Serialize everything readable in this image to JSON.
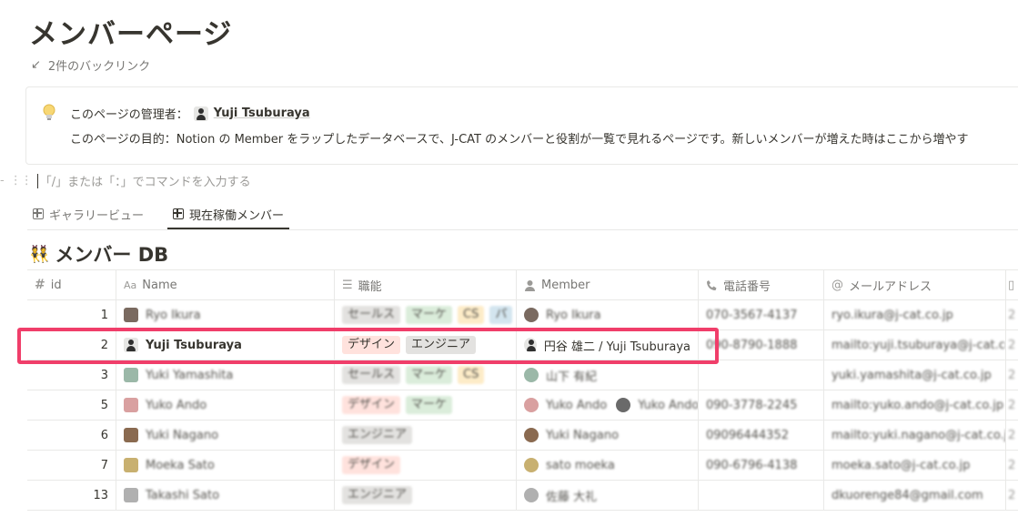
{
  "page": {
    "title": "メンバーページ",
    "backlinks_icon": "↙",
    "backlinks_label": "2件のバックリンク"
  },
  "callout": {
    "icon": "lightbulb-icon",
    "admin_label": "このページの管理者：",
    "admin_name": "Yuji Tsuburaya",
    "purpose": "このページの目的：Notion の Member をラップしたデータベースで、J-CAT のメンバーと役割が一覧で見れるページです。新しいメンバーが増えた時はここから増やす"
  },
  "command_hint": "「/」または「：」でコマンドを入力する",
  "tabs": [
    {
      "label": "ギャラリービュー",
      "active": false
    },
    {
      "label": "現在稼働メンバー",
      "active": true
    }
  ],
  "database": {
    "emoji": "👯",
    "title": "メンバー DB",
    "columns": [
      {
        "icon": "#",
        "label": "id"
      },
      {
        "icon": "Aa",
        "label": "Name"
      },
      {
        "icon": "☰",
        "label": "職能"
      },
      {
        "icon": "person",
        "label": "Member"
      },
      {
        "icon": "phone",
        "label": "電話番号"
      },
      {
        "icon": "@",
        "label": "メールアドレス"
      }
    ],
    "rows": [
      {
        "id": "1",
        "name": "Ryo Ikura",
        "tags": [
          [
            "セールス",
            "sales"
          ],
          [
            "マーケ",
            "mkt"
          ],
          [
            "CS",
            "cs"
          ],
          [
            "パ",
            "p"
          ]
        ],
        "member": "Ryo Ikura",
        "phone": "070-3567-4137",
        "email": "ryo.ikura@j-cat.co.jp",
        "blur": true,
        "av": "#7a6a60"
      },
      {
        "id": "2",
        "name": "Yuji Tsuburaya",
        "tags": [
          [
            "デザイン",
            "design"
          ],
          [
            "エンジニア",
            "eng"
          ]
        ],
        "member": "円谷 雄二 / Yuji Tsuburaya",
        "phone": "090-8790-1888",
        "email": "mailto:yuji.tsuburaya@j-cat.co.jp",
        "blur": false,
        "av": "#e6e6e4"
      },
      {
        "id": "3",
        "name": "Yuki Yamashita",
        "tags": [
          [
            "セールス",
            "sales"
          ],
          [
            "マーケ",
            "mkt"
          ],
          [
            "CS",
            "cs"
          ]
        ],
        "member": "山下 有紀",
        "phone": "",
        "email": "yuki.yamashita@j-cat.co.jp",
        "blur": true,
        "av": "#9bb8a8"
      },
      {
        "id": "5",
        "name": "Yuko Ando",
        "tags": [
          [
            "デザイン",
            "design"
          ],
          [
            "マーケ",
            "mkt"
          ]
        ],
        "member": "Yuko Ando",
        "member2": "Yuko Ando",
        "phone": "090-3778-2245",
        "email": "mailto:yuko.ando@j-cat.co.jp",
        "blur": true,
        "av": "#d9a0a0"
      },
      {
        "id": "6",
        "name": "Yuki Nagano",
        "tags": [
          [
            "エンジニア",
            "eng"
          ]
        ],
        "member": "Yuki Nagano",
        "phone": "09096444352",
        "email": "mailto:yuki.nagano@j-cat.co.jp",
        "blur": true,
        "av": "#8a6a50"
      },
      {
        "id": "7",
        "name": "Moeka Sato",
        "tags": [
          [
            "デザイン",
            "design"
          ]
        ],
        "member": "sato moeka",
        "phone": "090-6796-4138",
        "email": "moeka.sato@j-cat.co.jp",
        "blur": true,
        "av": "#c8b070"
      },
      {
        "id": "13",
        "name": "Takashi Sato",
        "tags": [
          [
            "エンジニア",
            "eng"
          ]
        ],
        "member": "佐藤 大礼",
        "phone": "",
        "email": "dkuorenge84@gmail.com",
        "blur": true,
        "av": "#b0b0b0"
      }
    ]
  },
  "colors": {
    "highlight": "#f03e6a",
    "text": "#37352f",
    "muted": "#787774"
  }
}
